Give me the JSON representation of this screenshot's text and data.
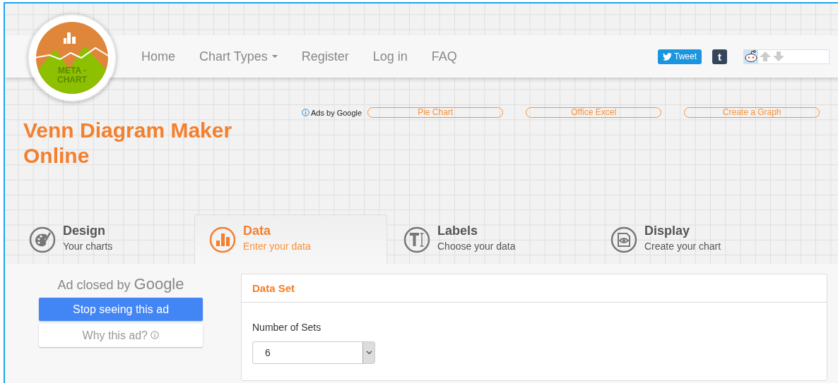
{
  "logo": {
    "lines": [
      "META -",
      "CHART"
    ]
  },
  "nav": {
    "links": [
      {
        "label": "Home",
        "kind": "link"
      },
      {
        "label": "Chart Types",
        "kind": "dropdown"
      },
      {
        "label": "Register",
        "kind": "link"
      },
      {
        "label": "Log in",
        "kind": "link"
      },
      {
        "label": "FAQ",
        "kind": "link"
      }
    ],
    "share": {
      "tweet": "Tweet",
      "tumblr": "t"
    }
  },
  "ads": {
    "label": "Ads by Google",
    "links": [
      "Pie Chart",
      "Office Excel",
      "Create a Graph"
    ]
  },
  "page_title": "Venn Diagram Maker Online",
  "tabs": [
    {
      "title": "Design",
      "subtitle": "Your charts",
      "kind": "design",
      "selected": false
    },
    {
      "title": "Data",
      "subtitle": "Enter your data",
      "kind": "data",
      "selected": true
    },
    {
      "title": "Labels",
      "subtitle": "Choose your data",
      "kind": "labels",
      "selected": false
    },
    {
      "title": "Display",
      "subtitle": "Create your chart",
      "kind": "display",
      "selected": false
    }
  ],
  "ad_notice": {
    "text": "Ad closed by",
    "brand": "Google",
    "stop_button": "Stop seeing this ad",
    "why_button": "Why this ad?"
  },
  "panel": {
    "title": "Data Set",
    "field_label": "Number of Sets",
    "value": "6"
  }
}
